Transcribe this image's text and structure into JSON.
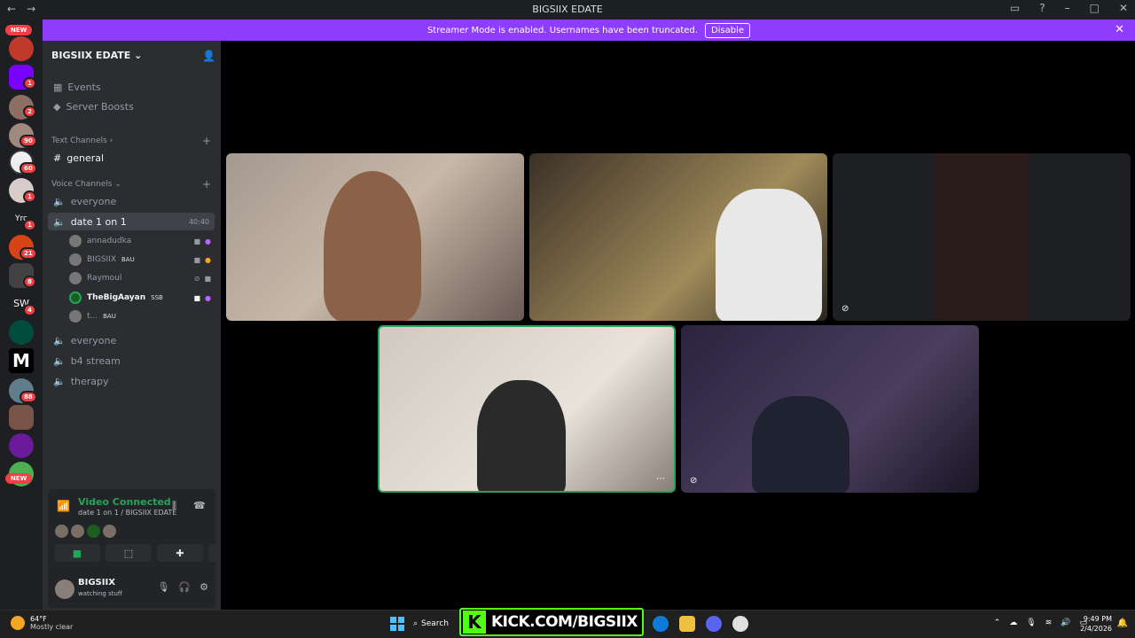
{
  "window": {
    "title": "BIGSIIX EDATE"
  },
  "banner": {
    "text": "Streamer Mode is enabled. Usernames have been truncated.",
    "disable_label": "Disable"
  },
  "guilds": {
    "badges": [
      "1",
      "1",
      "2",
      "90",
      "60",
      "1",
      "1",
      "21",
      "8",
      "4",
      "88"
    ],
    "new_label": "NEW",
    "server_abbrevs": [
      "Yrc",
      "SW",
      "M"
    ]
  },
  "server": {
    "name": "BIGSIIX EDATE",
    "events_label": "Events",
    "boosts_label": "Server Boosts",
    "text_category": "Text Channels",
    "text_channels": [
      {
        "name": "general"
      }
    ],
    "voice_category": "Voice Channels",
    "voice_channels": [
      {
        "name": "everyone"
      },
      {
        "name": "date 1 on 1",
        "time": "40:40"
      },
      {
        "name": "everyone"
      },
      {
        "name": "b4 stream"
      },
      {
        "name": "therapy"
      }
    ],
    "voice_users": [
      {
        "name": "annadudka",
        "tag": ""
      },
      {
        "name": "BIGSIIX",
        "tag": "BAU"
      },
      {
        "name": "Raymoul",
        "tag": ""
      },
      {
        "name": "TheBigAayan",
        "tag": "SSB"
      },
      {
        "name": "t...",
        "tag": "BAU"
      }
    ]
  },
  "voice_panel": {
    "status": "Video Connected",
    "location": "date 1 on 1 / BIGSIIX EDATE"
  },
  "user_panel": {
    "name": "BIGSIIX",
    "status": "watching stuff"
  },
  "taskbar": {
    "temp": "64°F",
    "weather": "Mostly clear",
    "search_label": "Search",
    "kick_text": "KICK.COM/BIGSIIX",
    "time": "9:49 PM",
    "date": "2/4/2026"
  },
  "colors": {
    "accent": "#8e3dff",
    "connected": "#23a559",
    "badge": "#f23f43",
    "kick": "#53fc18"
  }
}
